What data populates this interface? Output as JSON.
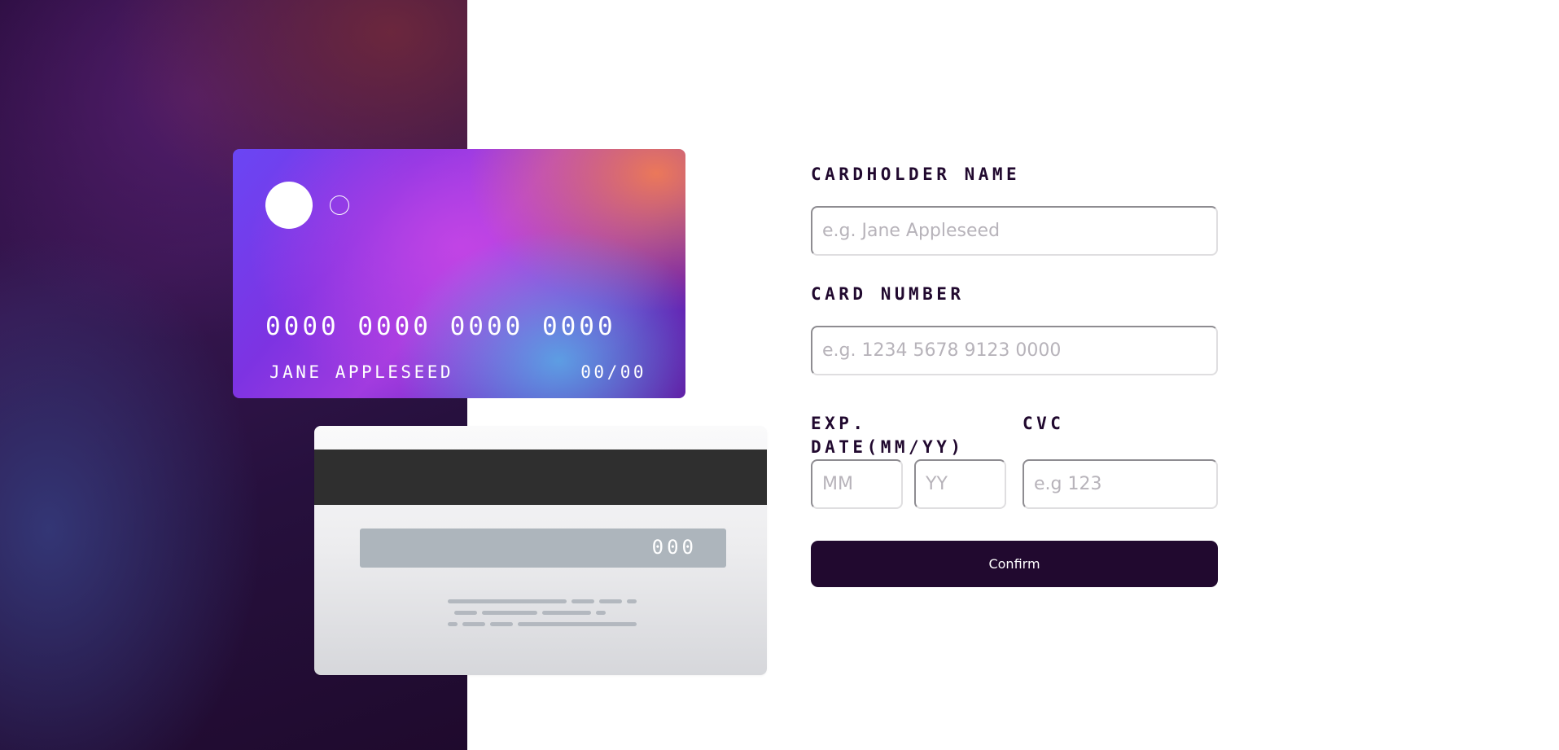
{
  "card_front": {
    "number": "0000 0000 0000 0000",
    "name": "JANE APPLESEED",
    "expiry": "00/00"
  },
  "card_back": {
    "cvc": "000"
  },
  "form": {
    "cardholder_label": "CARDHOLDER NAME",
    "cardholder_placeholder": "e.g. Jane Appleseed",
    "card_number_label": "CARD NUMBER",
    "card_number_placeholder": "e.g. 1234 5678 9123 0000",
    "exp_label_line1": "EXP.",
    "exp_label_line2": "DATE(MM/YY)",
    "month_placeholder": "MM",
    "year_placeholder": "YY",
    "cvc_label": "CVC",
    "cvc_placeholder": "e.g 123",
    "confirm_label": "Confirm"
  },
  "colors": {
    "dark_violet": "#21092f",
    "input_border": "#dfdee0",
    "placeholder": "#b7b3ba"
  }
}
